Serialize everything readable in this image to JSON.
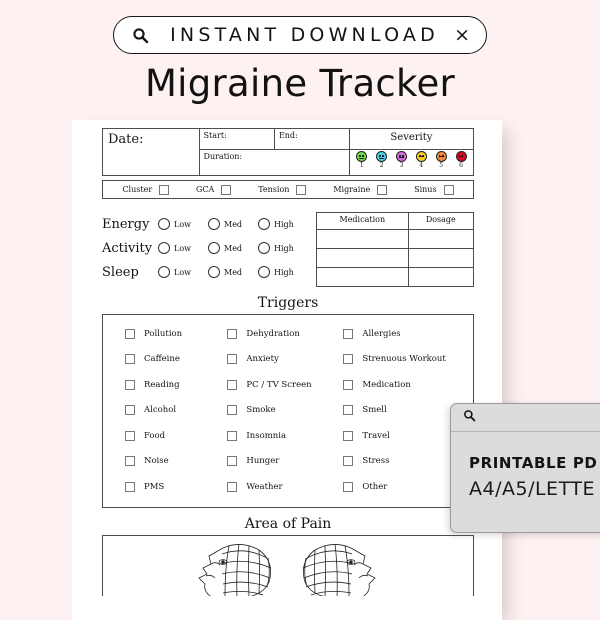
{
  "background_color": "#fdf2f1",
  "badge": {
    "search_icon": "search-icon",
    "label": "INSTANT DOWNLOAD",
    "close_icon": "×"
  },
  "heading": "Migraine Tracker",
  "sheet": {
    "header_table": {
      "date_label": "Date:",
      "start_label": "Start:",
      "end_label": "End:",
      "duration_label": "Duration:",
      "severity_label": "Severity",
      "severity_scale": [
        {
          "num": "1",
          "color": "#6fdc4a",
          "mood": "happy"
        },
        {
          "num": "2",
          "color": "#46d3e8",
          "mood": "happy"
        },
        {
          "num": "3",
          "color": "#d96ae0",
          "mood": "flat"
        },
        {
          "num": "4",
          "color": "#f5d024",
          "mood": "sad"
        },
        {
          "num": "5",
          "color": "#f08a3c",
          "mood": "sad"
        },
        {
          "num": "6",
          "color": "#d60b1e",
          "mood": "sad"
        }
      ]
    },
    "headache_types": [
      "Cluster",
      "GCA",
      "Tension",
      "Migraine",
      "Sinus"
    ],
    "levels": {
      "rows": [
        "Energy",
        "Activity",
        "Sleep"
      ],
      "options": [
        "Low",
        "Med",
        "High"
      ]
    },
    "medication_table": {
      "columns": [
        "Medication",
        "Dosage"
      ],
      "empty_rows": 3
    },
    "triggers": {
      "title": "Triggers",
      "rows": [
        [
          "Pollution",
          "Dehydration",
          "Allergies"
        ],
        [
          "Caffeine",
          "Anxiety",
          "Strenuous Workout"
        ],
        [
          "Reading",
          "PC / TV Screen",
          "Medication"
        ],
        [
          "Alcohol",
          "Smoke",
          "Smell"
        ],
        [
          "Food",
          "Insomnia",
          "Travel"
        ],
        [
          "Noise",
          "Hunger",
          "Stress"
        ],
        [
          "PMS",
          "Weather",
          "Other"
        ]
      ]
    },
    "area_of_pain": {
      "title": "Area of Pain"
    }
  },
  "overlay": {
    "search_icon": "search-icon",
    "line1": "PRINTABLE PD",
    "line2": "A4/A5/LETTE"
  }
}
